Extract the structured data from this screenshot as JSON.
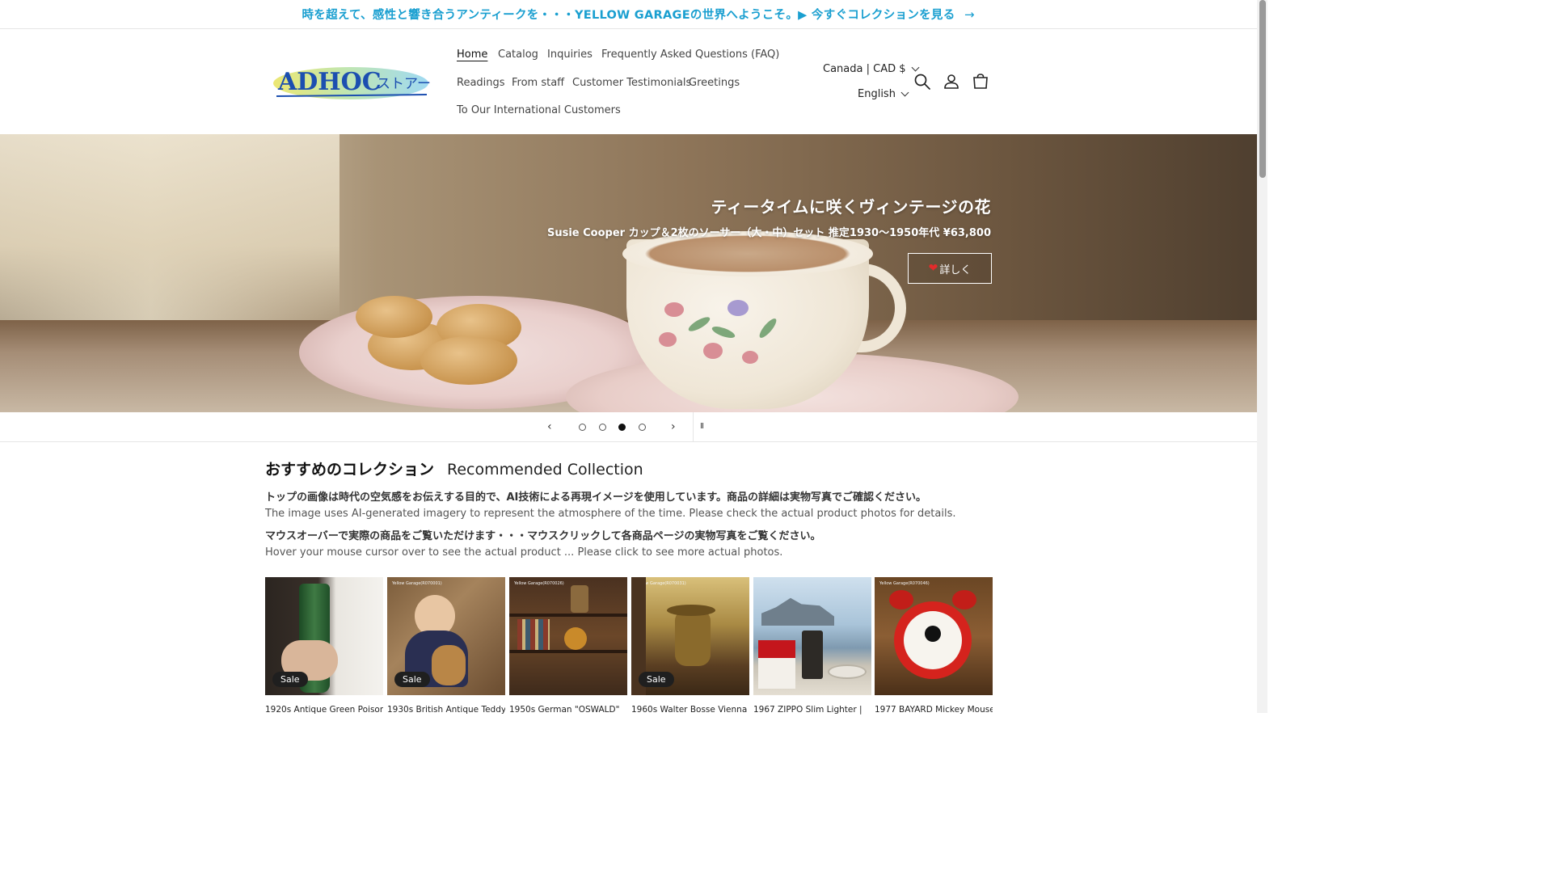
{
  "announcement": {
    "text": "時を超えて、感性と響き合うアンティークを・・・YELLOW GARAGEの世界へようこそ。▶ 今すぐコレクションを見る",
    "arrow": "→",
    "color": "#1a9fd0"
  },
  "header": {
    "logo_text": "ADHOC",
    "logo_sub": "ストアー",
    "nav": [
      {
        "label": "Home",
        "active": true
      },
      {
        "label": "Catalog"
      },
      {
        "label": "Inquiries"
      },
      {
        "label": "Frequently Asked Questions (FAQ)"
      },
      {
        "label": "Readings"
      },
      {
        "label": "From staff"
      },
      {
        "label": "Customer Testimonials"
      },
      {
        "label": "Greetings"
      },
      {
        "label": "To Our International Customers"
      }
    ],
    "country": "Canada | CAD $",
    "language": "English",
    "icons": [
      "search-icon",
      "account-icon",
      "cart-icon"
    ]
  },
  "hero": {
    "title": "ティータイムに咲くヴィンテージの花",
    "subtitle": "Susie Cooper カップ＆2枚のソーサー（大・中）セット 推定1930〜1950年代 ¥63,800",
    "button_heart": "❤",
    "button_label": "詳しく"
  },
  "slider": {
    "prev": "‹",
    "next": "›",
    "pause": "II",
    "slides": 4,
    "current": 3
  },
  "recommended": {
    "title_jp": "おすすめのコレクション",
    "title_en": "Recommended Collection",
    "lines": [
      "トップの画像は時代の空気感をお伝えする目的で、AI技術による再現イメージを使用しています。商品の詳細は実物写真でご確認ください。",
      "The image uses AI-generated imagery to represent the atmosphere of the time. Please check the actual product photos for details.",
      "マウスオーバーで実際の商品をご覧いただけます・・・マウスクリックして各商品ページの実物写真をご覧ください。",
      "Hover your mouse cursor over to see the actual product ... Please click to see more actual photos."
    ],
    "sale_label": "Sale",
    "products": [
      {
        "title": "1920s Antique Green Poison",
        "sale": true,
        "watermark": ""
      },
      {
        "title": "1930s British Antique Teddy",
        "sale": true,
        "watermark": "Yellow Garage(R070001)"
      },
      {
        "title": "1950s German \"OSWALD\"",
        "sale": false,
        "watermark": "Yellow Garage(R070026)"
      },
      {
        "title": "1960s Walter Bosse Vienna",
        "sale": true,
        "watermark": "Yellow Garage(R070031)"
      },
      {
        "title": "1967 ZIPPO Slim Lighter |",
        "sale": false,
        "watermark": ""
      },
      {
        "title": "1977 BAYARD Mickey Mouse",
        "sale": false,
        "watermark": "Yellow Garage(R070046)"
      }
    ]
  }
}
